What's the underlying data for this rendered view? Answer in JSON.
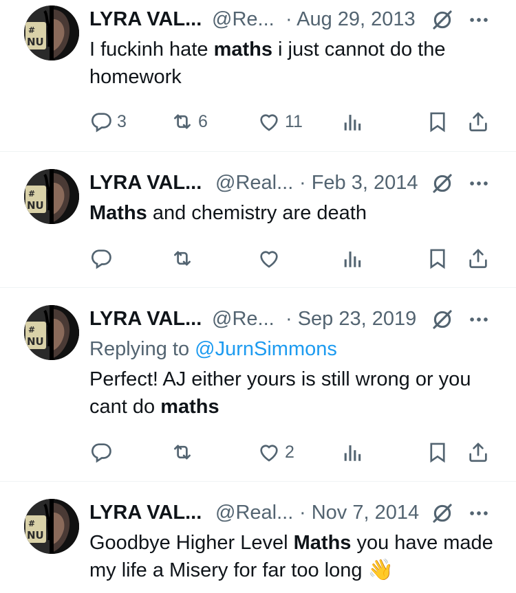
{
  "tweets": [
    {
      "name": "LYRA VAL...",
      "handle": "@Re...",
      "date": "· Aug 29, 2013",
      "text_parts": [
        "I fuckinh hate ",
        "maths",
        " i just cannot do the homework"
      ],
      "stats": {
        "replies": "3",
        "retweets": "6",
        "likes": "11"
      }
    },
    {
      "name": "LYRA VAL...",
      "handle": "@Real...",
      "date": "· Feb 3, 2014",
      "text_parts": [
        "Maths",
        " and chemistry are death"
      ],
      "stats": {
        "replies": "",
        "retweets": "",
        "likes": ""
      }
    },
    {
      "name": "LYRA VAL...",
      "handle": "@Re...",
      "date": "· Sep 23, 2019",
      "replying_prefix": "Replying to ",
      "replying_mention": "@JurnSimmons",
      "text_parts": [
        "Perfect! AJ either yours is still wrong or you cant do ",
        "maths"
      ],
      "stats": {
        "replies": "",
        "retweets": "",
        "likes": "2"
      }
    },
    {
      "name": "LYRA VAL...",
      "handle": "@Real...",
      "date": "· Nov 7, 2014",
      "text_parts": [
        "Goodbye Higher Level ",
        "Maths",
        " you have made my life a Misery for far too long "
      ],
      "emoji": "👋",
      "stats": {
        "replies": "",
        "retweets": "",
        "likes": ""
      }
    }
  ],
  "colors": {
    "text": "#0f1419",
    "secondary": "#536471",
    "link": "#1d9bf0",
    "divider": "#eff3f4"
  },
  "icons": [
    "reply-icon",
    "retweet-icon",
    "like-icon",
    "views-icon",
    "bookmark-icon",
    "share-icon",
    "grok-icon",
    "more-icon"
  ]
}
